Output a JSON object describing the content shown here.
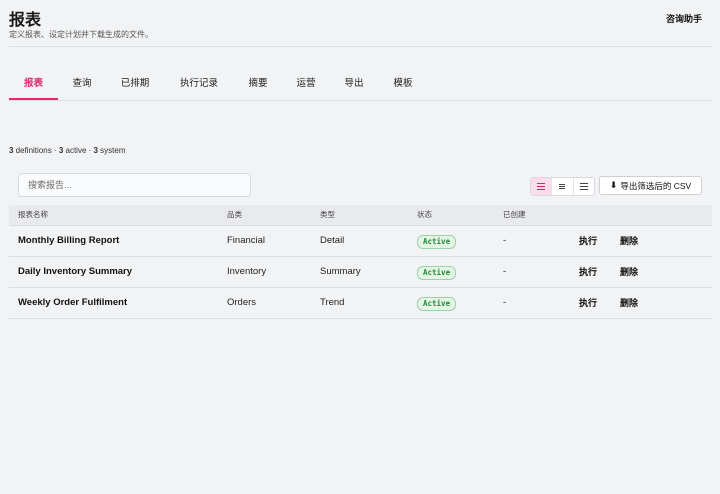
{
  "header": {
    "title": "报表",
    "subtitle": "定义报表、设定计划并下载生成的文件。",
    "assistant_label": "咨询助手"
  },
  "tabs": [
    {
      "label": "报表",
      "active": true
    },
    {
      "label": "查询",
      "active": false
    },
    {
      "label": "已排期",
      "active": false
    },
    {
      "label": "执行记录",
      "active": false
    },
    {
      "label": "摘要",
      "active": false
    },
    {
      "label": "运营",
      "active": false
    },
    {
      "label": "导出",
      "active": false
    },
    {
      "label": "模板",
      "active": false
    }
  ],
  "summary": {
    "definitions_count": "3",
    "definitions_label": " definitions · ",
    "active_count": "3",
    "active_label": " active · ",
    "system_count": "3",
    "system_label": " system"
  },
  "search": {
    "placeholder": "搜索报告...",
    "value": ""
  },
  "view_toggle": {
    "options": [
      "list-icon",
      "compact-list-icon",
      "detail-list-icon"
    ],
    "selected": "list-icon"
  },
  "export": {
    "icon": "download-icon",
    "label": "导出筛选后的 CSV"
  },
  "table": {
    "columns": [
      "报表名称",
      "品类",
      "类型",
      "状态",
      "已创建"
    ],
    "rows": [
      {
        "name": "Monthly Billing Report",
        "category": "Financial",
        "type": "Detail",
        "status": "Active",
        "created": "-",
        "run_label": "执行",
        "delete_label": "删除"
      },
      {
        "name": "Daily Inventory Summary",
        "category": "Inventory",
        "type": "Summary",
        "status": "Active",
        "created": "-",
        "run_label": "执行",
        "delete_label": "删除"
      },
      {
        "name": "Weekly Order Fulfilment",
        "category": "Orders",
        "type": "Trend",
        "status": "Active",
        "created": "-",
        "run_label": "执行",
        "delete_label": "删除"
      }
    ]
  },
  "colors": {
    "accent": "#e0286f",
    "status_active_text": "#1f8a3c",
    "status_active_bg": "#e4f5e6"
  }
}
